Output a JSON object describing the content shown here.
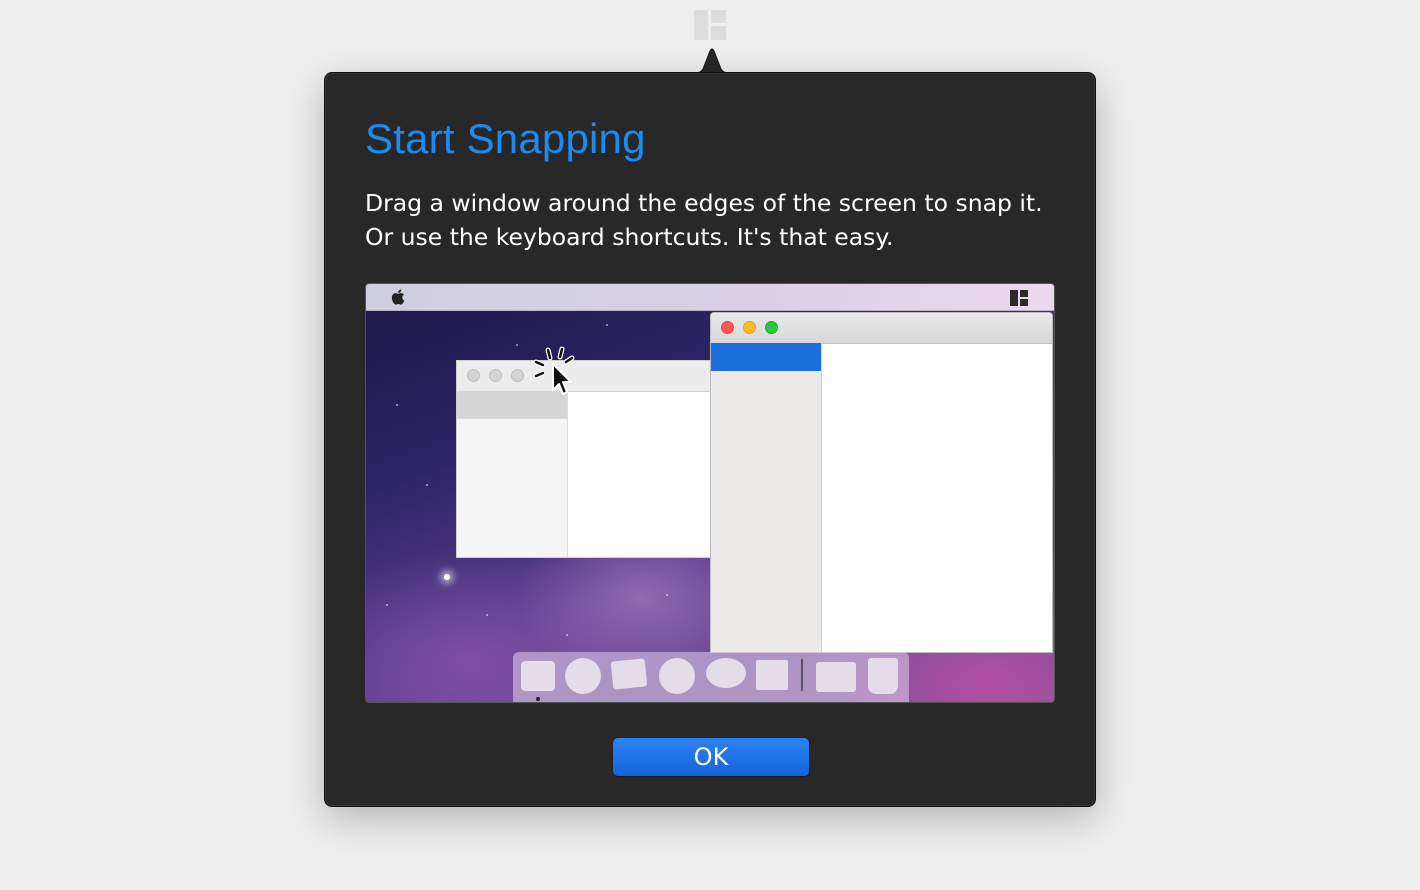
{
  "status_icon": "snap-layout-icon",
  "popover": {
    "title": "Start Snapping",
    "description": "Drag a window around the edges of the screen to snap it. Or use the keyboard shortcuts. It's that easy.",
    "ok_label": "OK"
  },
  "illustration": {
    "menubar_left_icon": "apple-logo-icon",
    "menubar_right_icon": "snap-layout-icon",
    "left_window_controls": [
      "close",
      "minimize",
      "zoom"
    ],
    "right_window_controls": [
      "close",
      "minimize",
      "zoom"
    ],
    "cursor_icon": "arrow-cursor-click-icon",
    "dock_items": [
      "square",
      "circle",
      "card",
      "circle",
      "speech-bubble",
      "square",
      "folder",
      "trash"
    ]
  },
  "colors": {
    "accent_title": "#1c8bf0",
    "button": "#1a6fe8",
    "popover_bg": "#282828",
    "close_dot": "#fd5b55",
    "minimize_dot": "#fdbc2e",
    "zoom_dot": "#2ac840",
    "sidebar_selection": "#1a6fdc"
  }
}
